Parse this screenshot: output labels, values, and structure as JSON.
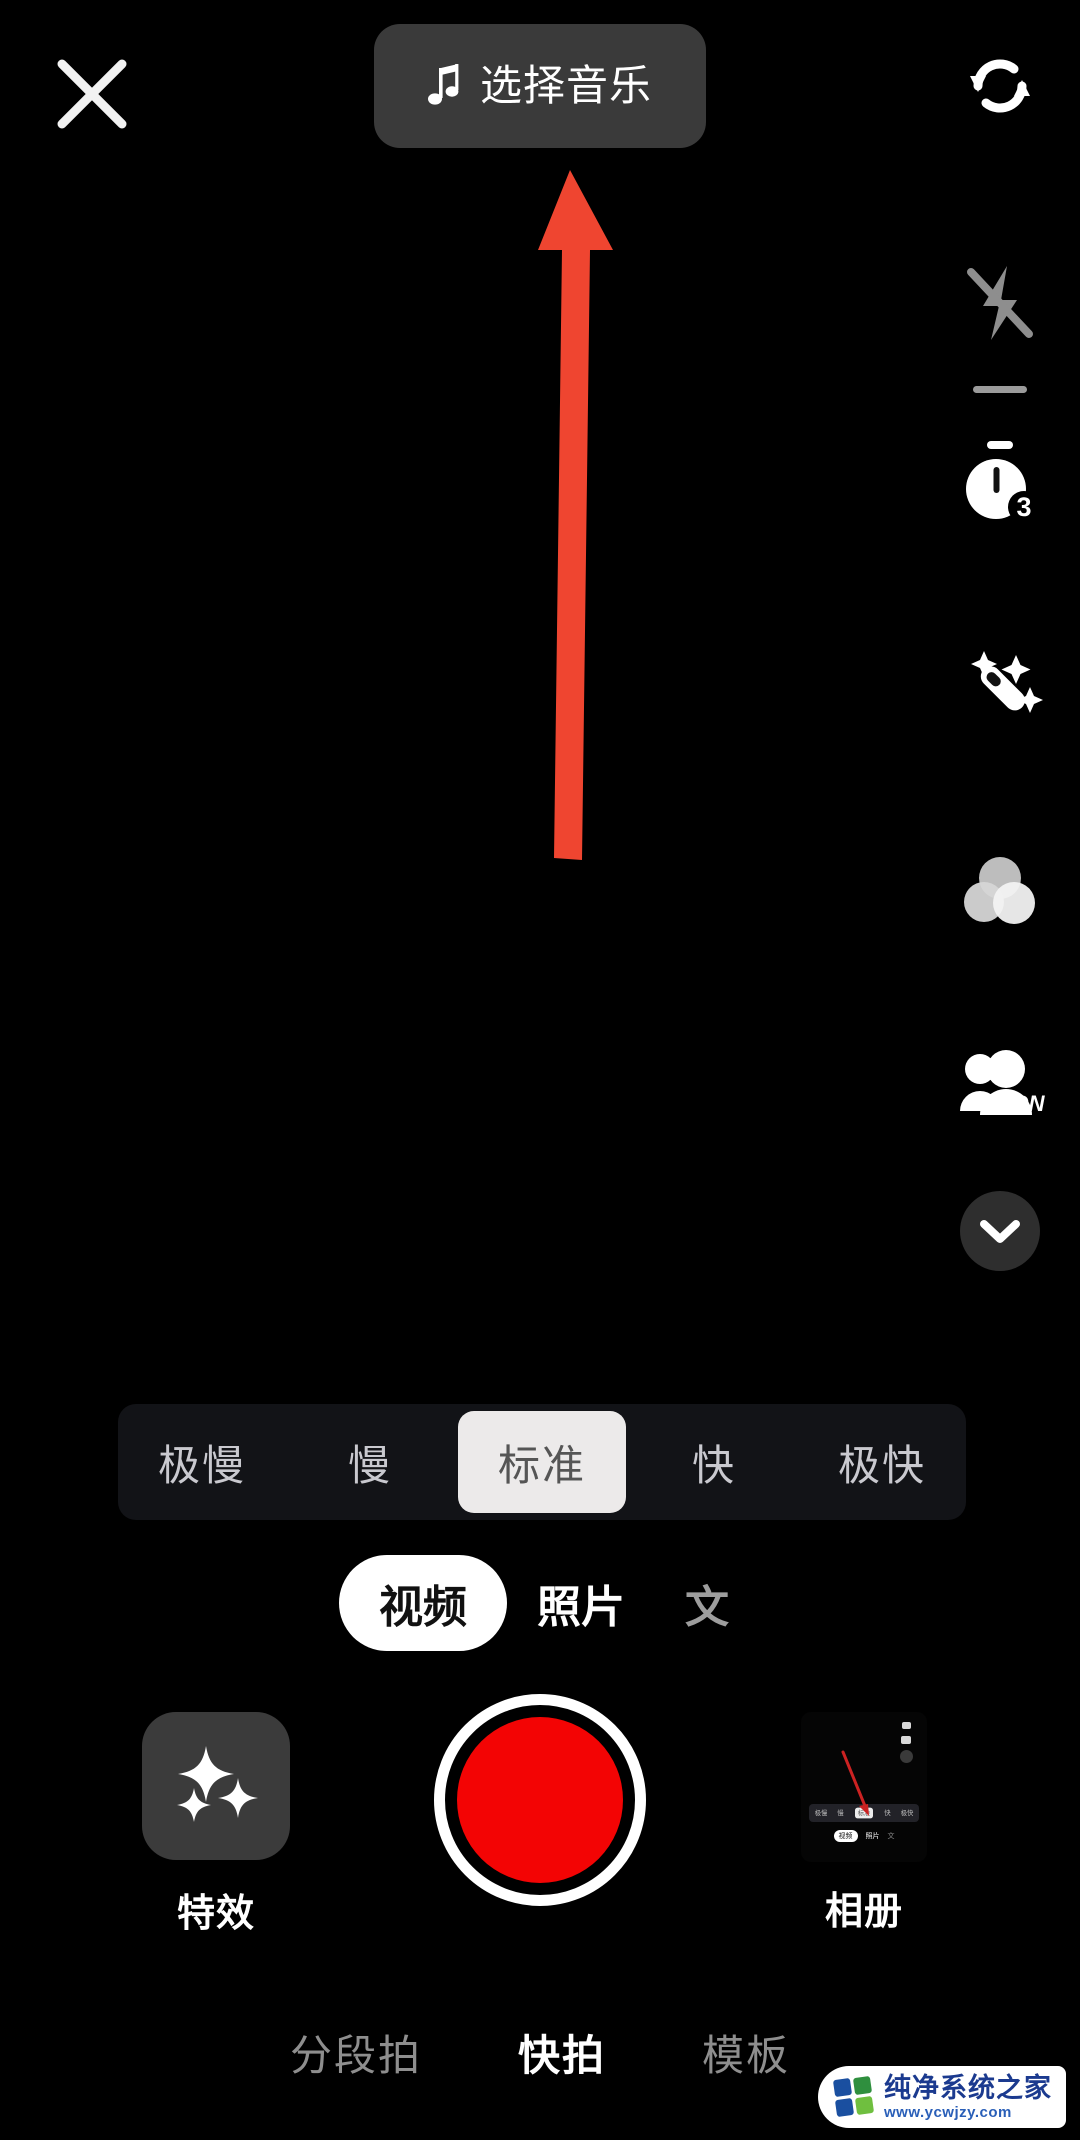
{
  "app": {
    "screen_name": "camera-capture",
    "background_color": "#000000"
  },
  "topbar": {
    "close_icon": "close-icon",
    "music_button": {
      "label": "选择音乐",
      "icon": "music-note-icon",
      "background_color": "#3a3a3a"
    }
  },
  "right_rail": {
    "items": [
      {
        "name": "flip-camera",
        "icon": "camera-flip-icon",
        "label": "",
        "color": "#ffffff"
      },
      {
        "name": "flash",
        "icon": "flash-off-icon",
        "label": "",
        "color": "#8e8e8e"
      },
      {
        "name": "timer",
        "icon": "timer-icon",
        "label": "3",
        "color": "#ffffff"
      },
      {
        "name": "beautify",
        "icon": "magic-wand-sparkle-icon",
        "label": "",
        "color": "#ffffff"
      },
      {
        "name": "filters",
        "icon": "three-circles-filter-icon",
        "label": "",
        "color": "#d9d9d9"
      },
      {
        "name": "duet-on",
        "icon": "people-icon",
        "label": "ON",
        "color": "#ffffff"
      }
    ],
    "collapse_button": {
      "icon": "chevron-down-icon",
      "background_color": "#2e2e2e"
    }
  },
  "annotation": {
    "type": "arrow",
    "direction": "up",
    "color": "#ef4530",
    "points_to": "选择音乐"
  },
  "speed_bar": {
    "background_color": "#121317",
    "active_background": "#eceaea",
    "options": [
      {
        "label": "极慢",
        "selected": false
      },
      {
        "label": "慢",
        "selected": false
      },
      {
        "label": "标准",
        "selected": true
      },
      {
        "label": "快",
        "selected": false
      },
      {
        "label": "极快",
        "selected": false
      }
    ]
  },
  "mode_tabs": [
    {
      "label": "视频",
      "selected": true
    },
    {
      "label": "照片",
      "selected": false
    },
    {
      "label": "文",
      "selected": false,
      "truncated": true
    }
  ],
  "capture_row": {
    "effects": {
      "label": "特效",
      "icon": "sparkles-icon",
      "tile_color": "#3b3b3b"
    },
    "record": {
      "name": "record-button",
      "fill_color": "#f30404",
      "ring_color": "#ffffff"
    },
    "album": {
      "label": "相册",
      "thumbnail": "last-screenshot-thumbnail"
    }
  },
  "album_thumbnail_mini": {
    "speed_options": [
      "极慢",
      "慢",
      "标准",
      "快",
      "极快"
    ],
    "speed_selected": "标准",
    "modes": [
      "视频",
      "照片",
      "文"
    ],
    "mode_selected": "视频"
  },
  "bottom_nav": [
    {
      "label": "分段拍",
      "selected": false
    },
    {
      "label": "快拍",
      "selected": true
    },
    {
      "label": "模板",
      "selected": false
    }
  ],
  "watermark": {
    "title": "纯净系统之家",
    "url": "www.ycwjzy.com",
    "logo_colors": [
      "#1a4fa0",
      "#2f8f3e",
      "#1a4fa0",
      "#6fbf3f"
    ]
  }
}
